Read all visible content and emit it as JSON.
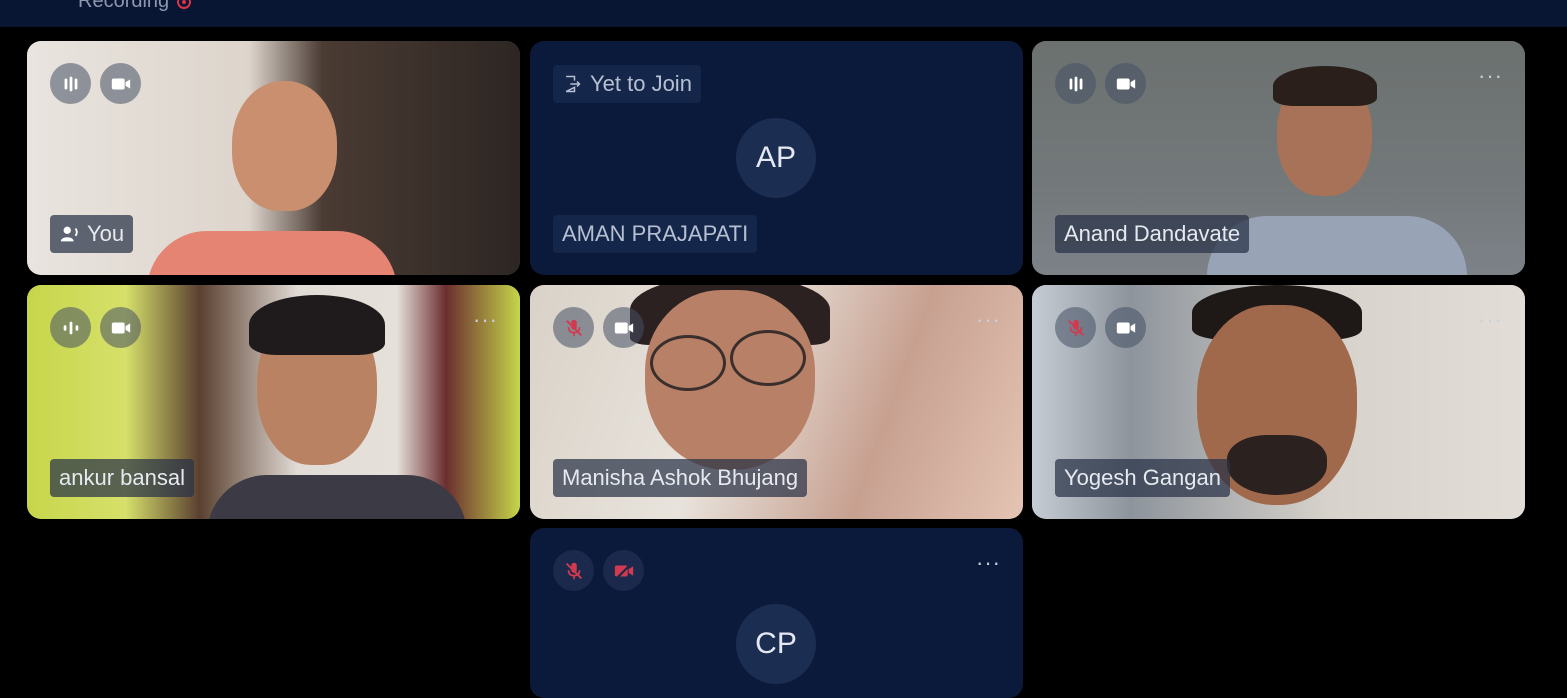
{
  "header": {
    "recording_label": "Recording"
  },
  "tiles": [
    {
      "name": "You",
      "type": "video",
      "mic": "speaking",
      "camera": "on",
      "speaking_icon": "speaker-icon"
    },
    {
      "name": "AMAN PRAJAPATI",
      "type": "avatar",
      "initials": "AP",
      "status": "Yet to Join"
    },
    {
      "name": "Anand Dandavate",
      "type": "video",
      "mic": "on",
      "camera": "on"
    },
    {
      "name": "ankur bansal",
      "type": "video",
      "mic": "speaking",
      "camera": "on"
    },
    {
      "name": "Manisha Ashok Bhujang",
      "type": "video",
      "mic": "muted",
      "camera": "on"
    },
    {
      "name": "Yogesh Gangan",
      "type": "video",
      "mic": "muted",
      "camera": "on"
    },
    {
      "name": "",
      "type": "avatar",
      "initials": "CP",
      "mic": "muted",
      "camera": "off"
    }
  ],
  "colors": {
    "background": "#000000",
    "tile_dark": "#0b1a3a",
    "muted_red": "#d23b4f",
    "topbar": "#081633"
  }
}
